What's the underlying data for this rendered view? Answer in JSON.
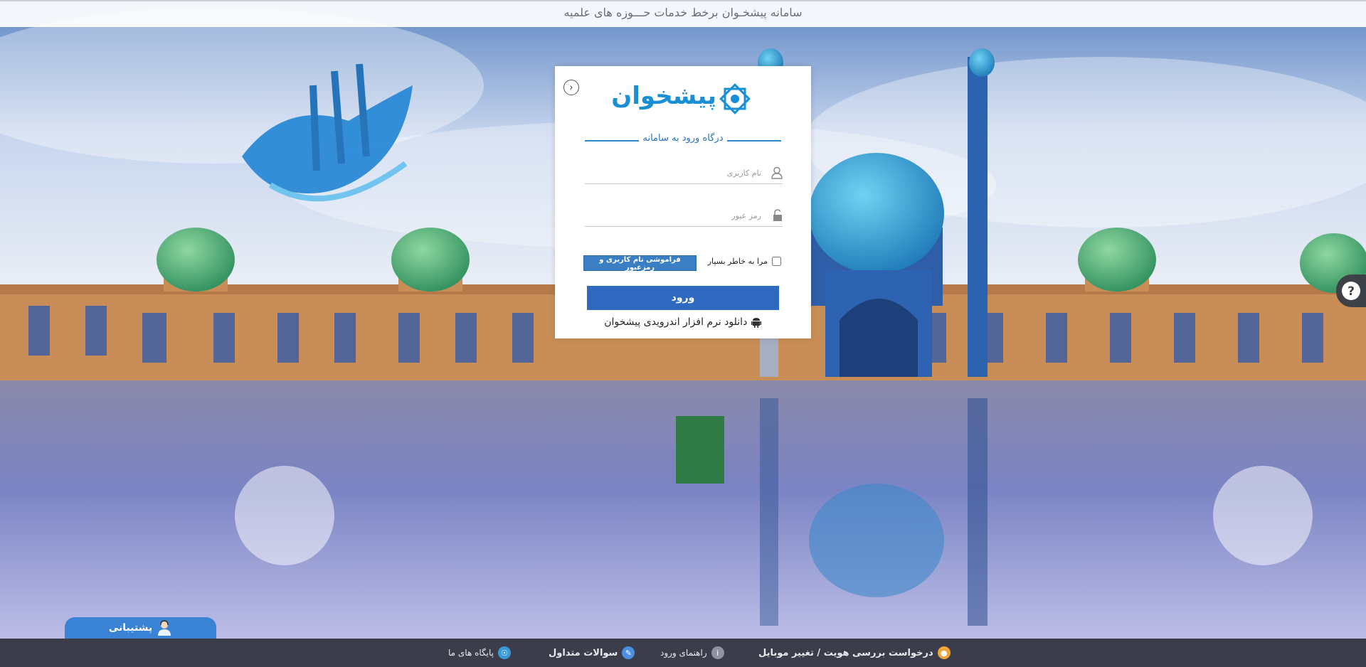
{
  "header": {
    "title": "سامانه پیشخـوان برخط خدمات حـــوزه های علمیه"
  },
  "login": {
    "logo_text": "پیشخوان",
    "portal_title": "درگاه ورود به سامانه",
    "username_placeholder": "نام کاربری",
    "password_placeholder": "رمز عبور",
    "remember_label": "مرا به خاطر بسپار",
    "forgot_label": "فراموشی نام کاربری و رمزعبور",
    "submit_label": "ورود",
    "android_label": "دانلود نرم افزار اندرویدی پیشخوان"
  },
  "support": {
    "label": "پشتیبانی"
  },
  "footer": {
    "items": [
      {
        "label": "درخواست بررسی هویت / تغییر موبایل",
        "icon": "user-icon",
        "color": "#f0a43a"
      },
      {
        "label": "راهنمای ورود",
        "icon": "info-icon",
        "color": "#8e93a2"
      },
      {
        "label": "سوالات متداول",
        "icon": "faq-icon",
        "color": "#4a8fe0"
      },
      {
        "label": "پایگاه های ما",
        "icon": "globe-icon",
        "color": "#3a9ad9"
      }
    ]
  },
  "colors": {
    "accent": "#2f6ac0",
    "footer_bg": "#3b3d4a",
    "logo_blue": "#1a8fd6"
  }
}
